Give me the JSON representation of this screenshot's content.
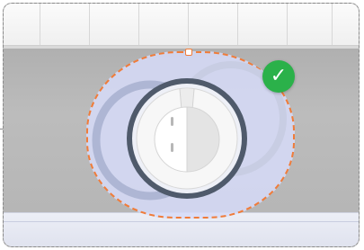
{
  "scene": {
    "description_label": "",
    "status": {
      "icon": "check-icon",
      "glyph": "✓",
      "color": "#2bb14a"
    },
    "selection": {
      "outline_color": "#f07c3a",
      "fill_color": "#d6dbf8"
    }
  },
  "colors": {
    "wall": "#b6b6b6",
    "ceiling": "#f2f2f2",
    "floor": "#e3e6f1",
    "ring_dark": "#4f5a6b",
    "ring_light": "#aeb6d4",
    "object_white": "#f7f7f7"
  }
}
